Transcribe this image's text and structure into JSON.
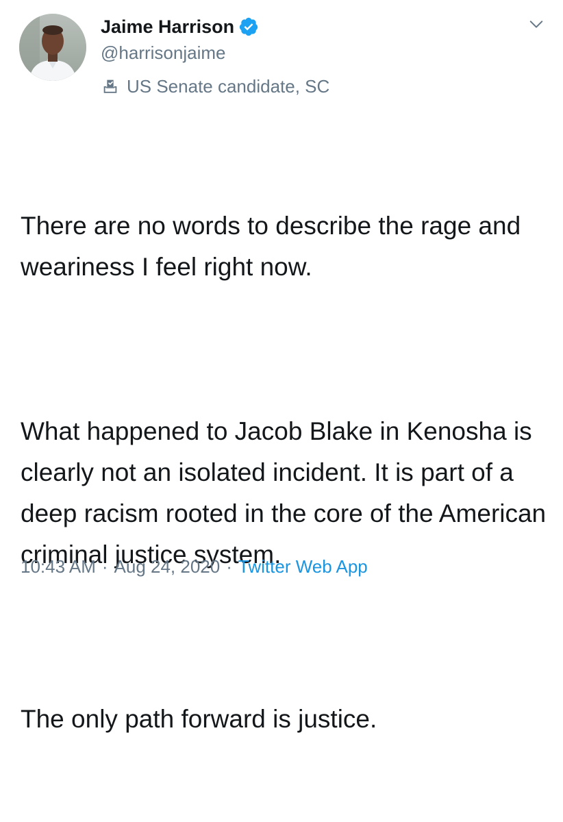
{
  "author": {
    "display_name": "Jaime Harrison",
    "handle": "@harrisonjaime",
    "label": "US Senate candidate, SC",
    "verified": true,
    "avatar_icon": "profile-photo"
  },
  "tweet": {
    "paragraphs": [
      "There are no words to describe the rage and weariness I feel right now.",
      "What happened to Jacob Blake in Kenosha is clearly not an isolated incident. It is part of a deep racism rooted in the core of the American criminal justice system.",
      "The only path forward is justice."
    ],
    "time": "10:43 AM",
    "date": "Aug 24, 2020",
    "separator": "·",
    "source": "Twitter Web App"
  },
  "colors": {
    "verified_blue": "#1da1f2",
    "secondary_text": "#657786",
    "link_blue": "#1b95e0",
    "primary_text": "#14171a"
  },
  "icons": {
    "verified": "verified-badge-icon",
    "ballot": "ballot-box-icon",
    "menu": "chevron-down-icon"
  }
}
